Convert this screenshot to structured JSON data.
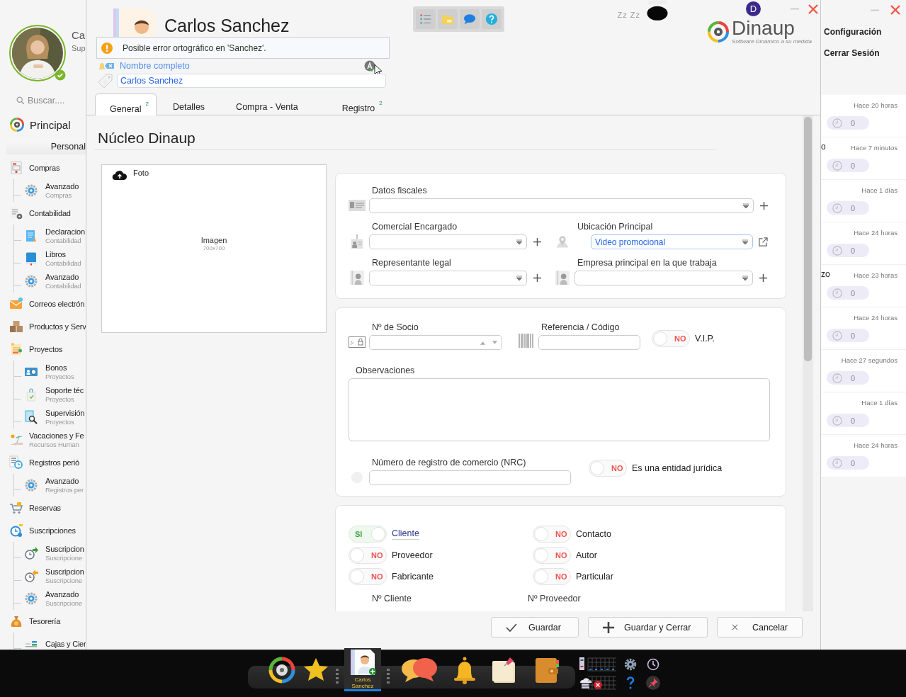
{
  "sidebar": {
    "user_name": "Ca",
    "user_role": "Sup",
    "search_placeholder": "Buscar....",
    "section": "Principal",
    "tab": "Personal",
    "items": [
      {
        "label": "Compras",
        "kind": "form",
        "children": [
          {
            "label": "Avanzado",
            "sub": "Compras",
            "kind": "gear"
          }
        ]
      },
      {
        "label": "Contabilidad",
        "kind": "list-gear",
        "children": [
          {
            "label": "Declaracion",
            "sub": "Contabilidad",
            "kind": "doc"
          },
          {
            "label": "Libros",
            "sub": "Contabilidad",
            "kind": "book"
          },
          {
            "label": "Avanzado",
            "sub": "Contabilidad",
            "kind": "gear"
          }
        ]
      },
      {
        "label": "Correos electrón",
        "kind": "mail"
      },
      {
        "label": "Productos y Serv",
        "kind": "boxes"
      },
      {
        "label": "Proyectos",
        "kind": "clipboard",
        "children": [
          {
            "label": "Bonos",
            "sub": "Proyectos",
            "kind": "card"
          },
          {
            "label": "Soporte téc",
            "sub": "Proyectos",
            "kind": "bag"
          },
          {
            "label": "Supervisión",
            "sub": "Proyectos",
            "kind": "magnifier"
          }
        ]
      },
      {
        "label": "Vacaciones y Fe",
        "sub": "Recursos Human",
        "kind": "umbrella"
      },
      {
        "label": "Registros perió",
        "kind": "list-clock",
        "children": [
          {
            "label": "Avanzado",
            "sub": "Registros per",
            "kind": "gear"
          }
        ]
      },
      {
        "label": "Reservas",
        "kind": "cart"
      },
      {
        "label": "Suscripciones",
        "kind": "stopwatch",
        "children": [
          {
            "label": "Suscripcion",
            "sub": "Suscripcione",
            "kind": "stopwatch-in"
          },
          {
            "label": "Suscripcion",
            "sub": "Suscripcione",
            "kind": "stopwatch-out"
          },
          {
            "label": "Avanzado",
            "sub": "Suscripcione",
            "kind": "gear"
          }
        ]
      },
      {
        "label": "Tesorería",
        "kind": "money",
        "children": [
          {
            "label": "Cajas y Cier",
            "kind": "cash"
          }
        ]
      }
    ]
  },
  "header": {
    "title": "Carlos Sanchez",
    "sleep": "Zz Zz",
    "user_initial": "D",
    "logo": "Dinaup",
    "logo_tagline": "Software Dinámico a su medida"
  },
  "tooltip": "Posible error ortográfico en 'Sanchez'.",
  "name_field": {
    "label": "Nombre completo",
    "value": "Carlos Sanchez"
  },
  "tabs": [
    {
      "label": "General",
      "badge": "2",
      "selected": true
    },
    {
      "label": "Detalles",
      "selected": false
    },
    {
      "label": "Compra - Venta",
      "selected": false
    },
    {
      "label": "Registro",
      "badge": "2",
      "selected": false
    }
  ],
  "section_title": "Núcleo Dinaup",
  "photo": {
    "label": "Foto",
    "placeholder": "Imagen",
    "size": "700x700"
  },
  "card1": {
    "fiscal": "Datos fiscales",
    "comercial": "Comercial Encargado",
    "ubicacion": "Ubicación Principal",
    "ubicacion_value": "Video promocional",
    "representante": "Representante legal",
    "empresa": "Empresa principal en la que trabaja"
  },
  "card2": {
    "socio": "Nº de Socio",
    "referencia": "Referencia / Código",
    "vip": {
      "state": "NO",
      "on": false,
      "label": "V.I.P."
    },
    "observaciones": "Observaciones",
    "nrc": "Número de registro de comercio (NRC)",
    "juridica": {
      "state": "NO",
      "on": false,
      "label": "Es una entidad jurídica"
    }
  },
  "roles": [
    {
      "state": "SI",
      "on": true,
      "label": "Cliente"
    },
    {
      "state": "NO",
      "on": false,
      "label": "Contacto"
    },
    {
      "state": "NO",
      "on": false,
      "label": "Proveedor"
    },
    {
      "state": "NO",
      "on": false,
      "label": "Autor"
    },
    {
      "state": "NO",
      "on": false,
      "label": "Fabricante"
    },
    {
      "state": "NO",
      "on": false,
      "label": "Particular"
    }
  ],
  "numbers": [
    "Nº Cliente",
    "Nº Proveedor"
  ],
  "buttons": [
    {
      "label": "Guardar",
      "kind": "check"
    },
    {
      "label": "Guardar y Cerrar",
      "kind": "plus"
    },
    {
      "label": "Cancelar",
      "kind": "cross"
    }
  ],
  "right_panel": {
    "menu": [
      "Configuración",
      "Cerrar Sesión"
    ],
    "notifications": [
      {
        "time": "Hace 20 horas",
        "count": "0"
      },
      {
        "title": "o",
        "time": "Hace 7 minutos",
        "count": "0"
      },
      {
        "time": "Hace 1 días",
        "count": "0"
      },
      {
        "time": "Hace 24 horas",
        "count": "0"
      },
      {
        "title": "zo",
        "time": "Hace 23 horas",
        "count": "0"
      },
      {
        "time": "Hace 24 horas",
        "count": "0"
      },
      {
        "time": "Hace 27 segundos",
        "count": "0"
      },
      {
        "time": "Hace 1 días",
        "count": "0"
      },
      {
        "time": "Hace 24 horas",
        "count": "0"
      }
    ]
  },
  "taskbar": [
    {
      "kind": "dashboard",
      "selected": false
    },
    {
      "kind": "star",
      "selected": false
    },
    {
      "kind": "contact",
      "label": "Carlos Sanchez",
      "selected": true
    },
    {
      "kind": "chat",
      "selected": false
    },
    {
      "kind": "bell",
      "selected": false
    },
    {
      "kind": "note",
      "selected": false
    },
    {
      "kind": "wallet",
      "selected": false
    }
  ]
}
